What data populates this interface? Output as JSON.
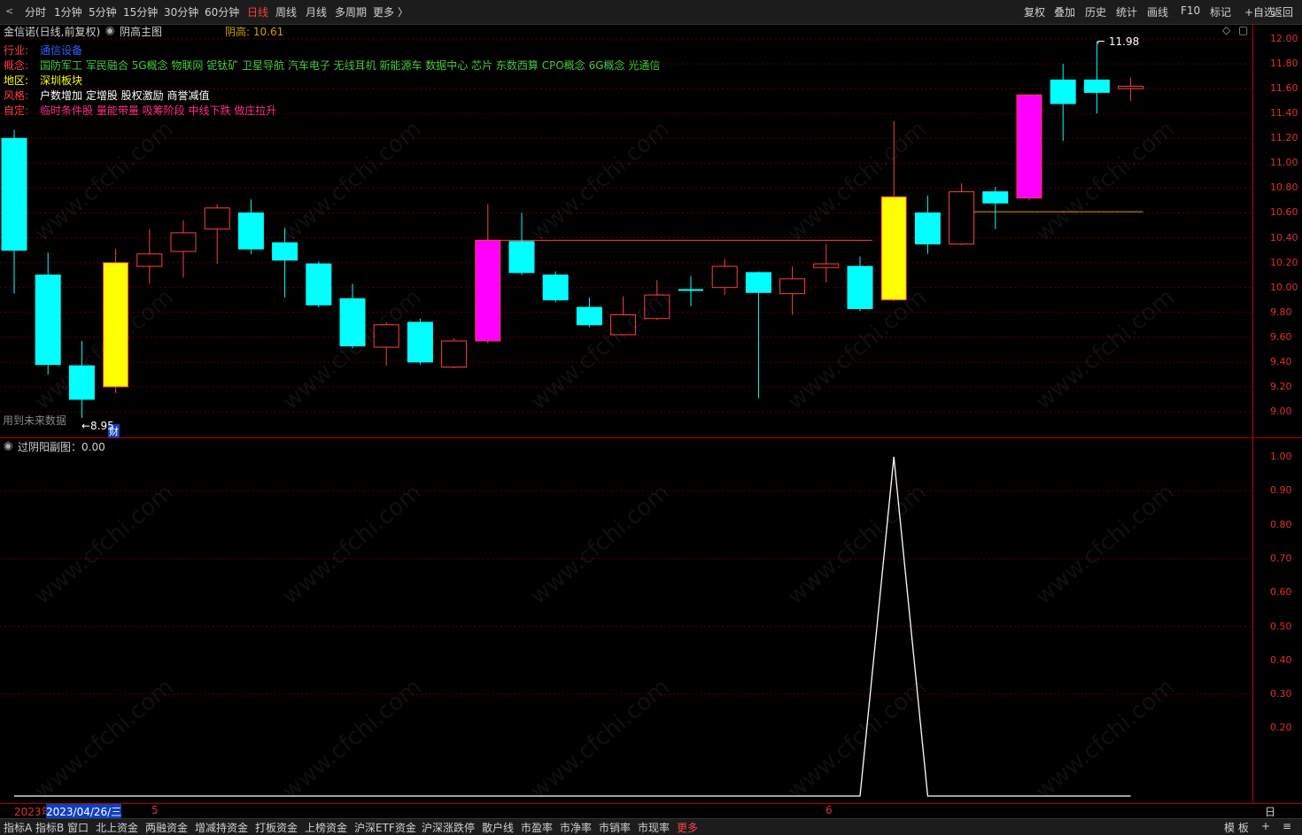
{
  "toolbar": {
    "left_items": [
      "分时",
      "1分钟",
      "5分钟",
      "15分钟",
      "30分钟",
      "60分钟",
      "日线",
      "周线",
      "月线",
      "多周期",
      "更多 〉"
    ],
    "active": "日线",
    "right_items": [
      "复权",
      "叠加",
      "历史",
      "统计",
      "画线",
      "F10",
      "标记",
      "+自选",
      "返回"
    ]
  },
  "main": {
    "stock_title": "金信诺(日线,前复权)",
    "indicator_name": "阴高主图",
    "indicator_value_label": "阴高: 10.61",
    "info": {
      "industry_label": "行业:",
      "industry_value": "通信设备",
      "concept_label": "概念:",
      "concept_value": "国防军工 军民融合 5G概念 物联网 铌钛矿 卫星导航 汽车电子 无线耳机 新能源车 数据中心 芯片 东数西算 CPO概念 6G概念 光通信",
      "region_label": "地区:",
      "region_value": "深圳板块",
      "style_label": "风格:",
      "style_value": "户数增加 定增股 股权激励 商誉减值",
      "custom_label": "自定:",
      "custom_value": "临时条件股 量能带量 吸筹阶段 中线下跌 做庄拉升"
    },
    "future_data_note": "用到未来数据",
    "low_marker": "8.95",
    "high_marker": "11.98",
    "cai_badge": "财",
    "y_axis": [
      "12.00",
      "11.80",
      "11.60",
      "11.40",
      "11.20",
      "11.00",
      "10.80",
      "10.60",
      "10.40",
      "10.20",
      "10.00",
      "9.80",
      "9.60",
      "9.40",
      "9.20",
      "9.00"
    ]
  },
  "sub": {
    "title": "过阴阳副图：0.00",
    "y_axis": [
      "1.00",
      "0.90",
      "0.80",
      "0.70",
      "0.60",
      "0.50",
      "0.40",
      "0.30",
      "0.20"
    ]
  },
  "date_row": {
    "year": "2023年",
    "selected_date": "2023/04/26/三",
    "month5": "5",
    "month6": "6",
    "period_label": "日线"
  },
  "bottom_bar": {
    "items": [
      "指标A",
      "指标B",
      "窗口",
      "北上资金",
      "两融资金",
      "增减持资金",
      "打板资金",
      "上榜资金",
      "沪深ETF资金",
      "沪深涨跌停",
      "散户线",
      "市盈率",
      "市净率",
      "市销率",
      "市现率",
      "更多"
    ],
    "right_items": [
      "模 板",
      "+",
      "≡"
    ]
  },
  "watermark": "www.cfchi.com",
  "colors": {
    "up": "#ff4040",
    "down": "#00ffff",
    "yellow": "#ffff00",
    "magenta": "#ff00ff",
    "axis": "#e03030"
  },
  "chart_data": {
    "type": "candlestick",
    "price_range": [
      8.85,
      12.1
    ],
    "candles": [
      {
        "o": 11.2,
        "h": 11.27,
        "l": 9.95,
        "c": 10.3,
        "kind": "down"
      },
      {
        "o": 10.1,
        "h": 10.28,
        "l": 9.3,
        "c": 9.38,
        "kind": "down"
      },
      {
        "o": 9.37,
        "h": 9.57,
        "l": 8.95,
        "c": 9.1,
        "kind": "down"
      },
      {
        "o": 9.2,
        "h": 10.31,
        "l": 9.15,
        "c": 10.2,
        "kind": "yellow"
      },
      {
        "o": 10.17,
        "h": 10.47,
        "l": 10.03,
        "c": 10.27,
        "kind": "up"
      },
      {
        "o": 10.29,
        "h": 10.54,
        "l": 10.08,
        "c": 10.44,
        "kind": "up"
      },
      {
        "o": 10.47,
        "h": 10.67,
        "l": 10.19,
        "c": 10.64,
        "kind": "up"
      },
      {
        "o": 10.6,
        "h": 10.71,
        "l": 10.27,
        "c": 10.31,
        "kind": "down"
      },
      {
        "o": 10.36,
        "h": 10.48,
        "l": 9.92,
        "c": 10.22,
        "kind": "down"
      },
      {
        "o": 10.19,
        "h": 10.21,
        "l": 9.84,
        "c": 9.86,
        "kind": "down"
      },
      {
        "o": 9.91,
        "h": 10.03,
        "l": 9.51,
        "c": 9.53,
        "kind": "down"
      },
      {
        "o": 9.52,
        "h": 9.72,
        "l": 9.37,
        "c": 9.7,
        "kind": "up"
      },
      {
        "o": 9.72,
        "h": 9.75,
        "l": 9.38,
        "c": 9.4,
        "kind": "down"
      },
      {
        "o": 9.36,
        "h": 9.59,
        "l": 9.35,
        "c": 9.57,
        "kind": "up"
      },
      {
        "o": 9.57,
        "h": 10.67,
        "l": 9.55,
        "c": 10.38,
        "kind": "magenta"
      },
      {
        "o": 10.37,
        "h": 10.6,
        "l": 10.1,
        "c": 10.12,
        "kind": "down"
      },
      {
        "o": 10.1,
        "h": 10.13,
        "l": 9.88,
        "c": 9.9,
        "kind": "down"
      },
      {
        "o": 9.84,
        "h": 9.92,
        "l": 9.68,
        "c": 9.7,
        "kind": "down"
      },
      {
        "o": 9.62,
        "h": 9.93,
        "l": 9.62,
        "c": 9.78,
        "kind": "up"
      },
      {
        "o": 9.75,
        "h": 10.06,
        "l": 9.74,
        "c": 9.94,
        "kind": "up"
      },
      {
        "o": 9.98,
        "h": 10.09,
        "l": 9.85,
        "c": 9.98,
        "kind": "cross"
      },
      {
        "o": 10.0,
        "h": 10.23,
        "l": 9.94,
        "c": 10.17,
        "kind": "up"
      },
      {
        "o": 10.12,
        "h": 10.13,
        "l": 9.11,
        "c": 9.96,
        "kind": "down"
      },
      {
        "o": 9.95,
        "h": 10.17,
        "l": 9.78,
        "c": 10.07,
        "kind": "up"
      },
      {
        "o": 10.16,
        "h": 10.35,
        "l": 10.04,
        "c": 10.19,
        "kind": "up"
      },
      {
        "o": 10.17,
        "h": 10.25,
        "l": 9.81,
        "c": 9.83,
        "kind": "down"
      },
      {
        "o": 9.9,
        "h": 11.34,
        "l": 9.89,
        "c": 10.73,
        "kind": "yellow"
      },
      {
        "o": 10.6,
        "h": 10.74,
        "l": 10.27,
        "c": 10.35,
        "kind": "down"
      },
      {
        "o": 10.35,
        "h": 10.84,
        "l": 10.34,
        "c": 10.77,
        "kind": "up"
      },
      {
        "o": 10.77,
        "h": 10.81,
        "l": 10.47,
        "c": 10.68,
        "kind": "down"
      },
      {
        "o": 10.72,
        "h": 11.55,
        "l": 10.7,
        "c": 11.55,
        "kind": "magenta"
      },
      {
        "o": 11.67,
        "h": 11.8,
        "l": 11.18,
        "c": 11.48,
        "kind": "down"
      },
      {
        "o": 11.67,
        "h": 11.98,
        "l": 11.4,
        "c": 11.57,
        "kind": "down"
      },
      {
        "o": 11.62,
        "h": 11.69,
        "l": 11.5,
        "c": 11.6,
        "kind": "up"
      }
    ],
    "resistance_lines": [
      {
        "value": 10.38,
        "from_index": 14,
        "to_index": 25,
        "color": "#ff4040"
      },
      {
        "value": 10.61,
        "from_index": 28,
        "to_index": 33,
        "color": "#c8a000"
      }
    ],
    "sub_series": {
      "name": "过阴阳副图",
      "range": [
        0,
        1.0
      ],
      "values": [
        0,
        0,
        0,
        0,
        0,
        0,
        0,
        0,
        0,
        0,
        0,
        0,
        0,
        0,
        0,
        0,
        0,
        0,
        0,
        0,
        0,
        0,
        0,
        0,
        0,
        0,
        1,
        0,
        0,
        0,
        0,
        0,
        0,
        0
      ]
    }
  }
}
